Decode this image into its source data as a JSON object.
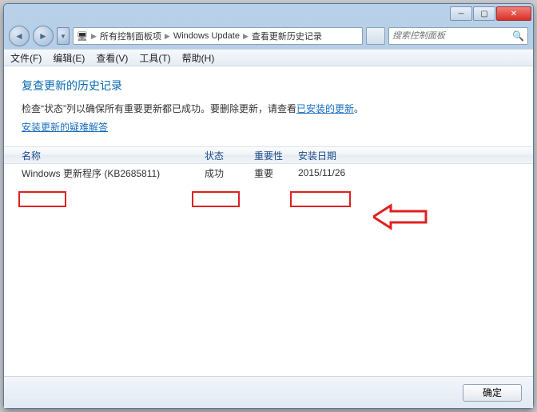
{
  "titlebar": {
    "title": ""
  },
  "nav": {
    "breadcrumb": [
      "所有控制面板项",
      "Windows Update",
      "查看更新历史记录"
    ]
  },
  "search": {
    "placeholder": "搜索控制面板"
  },
  "menu": {
    "file": "文件(F)",
    "edit": "编辑(E)",
    "view": "查看(V)",
    "tools": "工具(T)",
    "help": "帮助(H)"
  },
  "content": {
    "heading": "复查更新的历史记录",
    "subtext_prefix": "检查“状态”列以确保所有重要更新都已成功。要删除更新，请查看",
    "subtext_link": "已安装的更新",
    "subtext_suffix": "。",
    "troubleshoot": "安装更新的疑难解答"
  },
  "table": {
    "columns": {
      "name": "名称",
      "status": "状态",
      "importance": "重要性",
      "date": "安装日期"
    },
    "rows": [
      {
        "name": "Windows 更新程序 (KB2685811)",
        "status": "成功",
        "importance": "重要",
        "date": "2015/11/26"
      }
    ]
  },
  "footer": {
    "ok": "确定"
  }
}
